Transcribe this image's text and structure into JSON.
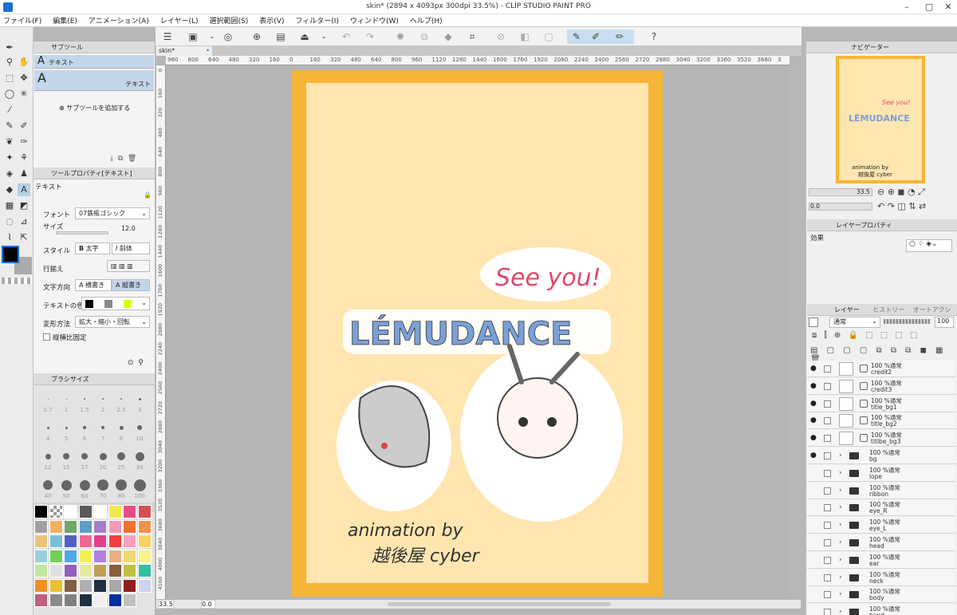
{
  "window": {
    "title": "skin* (2894 x 4093px 300dpi 33.5%)  - CLIP STUDIO PAINT PRO"
  },
  "menu": [
    "ファイル(F)",
    "編集(E)",
    "アニメーション(A)",
    "レイヤー(L)",
    "選択範囲(S)",
    "表示(V)",
    "フィルター(I)",
    "ウィンドウ(W)",
    "ヘルプ(H)"
  ],
  "subtool": {
    "header": "サブツール",
    "item1": "テキスト",
    "item2": "テキスト",
    "add": "サブツールを追加する"
  },
  "toolprop": {
    "header": "ツールプロパティ[テキスト]",
    "title": "テキスト",
    "font_label": "フォント",
    "font_value": "07鉄瓶ゴシック",
    "size_label": "サイズ",
    "size_value": "12.0",
    "style_label": "スタイル",
    "bold": "太字",
    "italic": "斜体",
    "align_label": "行揃え",
    "dir_label": "文字方向",
    "dir_h": "横書き",
    "dir_v": "縦書き",
    "color_label": "テキストの色",
    "transform_label": "変形方法",
    "transform_value": "拡大・縮小・回転",
    "aspect_label": "縦横比固定"
  },
  "brush": {
    "header": "ブラシサイズ",
    "sizes": [
      "0.7",
      "1",
      "1.5",
      "2",
      "2.5",
      "3",
      "4",
      "5",
      "6",
      "7",
      "8",
      "10",
      "12",
      "15",
      "17",
      "20",
      "25",
      "30",
      "40",
      "50",
      "60",
      "70",
      "80",
      "100"
    ]
  },
  "palette": {
    "colors": [
      "#000000",
      "checker",
      "#ffffff",
      "#5a5a5a",
      "#ffffff",
      "#f0e84a",
      "#e64b8a",
      "#d45050",
      "#a0a0a0",
      "#f5b062",
      "#6fa86a",
      "#5e9ec8",
      "#a080c8",
      "#f29ab8",
      "#f07030",
      "#f09050",
      "#e8c478",
      "#78c0d8",
      "#5060c0",
      "#f06890",
      "#e04090",
      "#f04040",
      "#f8a0c0",
      "#f8d060",
      "#98d0d8",
      "#70d058",
      "#50a8e8",
      "#f0f050",
      "#b080e0",
      "#e8b080",
      "#f0d870",
      "#f8f088",
      "#c0e8a0",
      "#e0e0e0",
      "#9060c0",
      "#e8e8a0",
      "#c0a058",
      "#886040",
      "#c0c040",
      "#30c0a0",
      "#f09020",
      "#e8c030",
      "#806040",
      "#b0b0b0",
      "#203040",
      "#a8a8a8",
      "#902020",
      "#d0d0f0",
      "#c06080",
      "#8a8a8a",
      "#808080",
      "#203040",
      "#f0f0f0",
      "#0030a0",
      "#c0c0c0"
    ]
  },
  "canvas": {
    "tab": "skin*",
    "zoom": "33.5",
    "angle": "0.0",
    "ruler_top": [
      "960",
      "800",
      "640",
      "480",
      "320",
      "160",
      "0",
      "160",
      "320",
      "480",
      "640",
      "800",
      "960",
      "1120",
      "1280",
      "1440",
      "1600",
      "1760",
      "1920",
      "2080",
      "2240",
      "2400",
      "2560",
      "2720",
      "2880",
      "3040",
      "3200",
      "3360",
      "3520",
      "3680",
      "3"
    ],
    "ruler_left": [
      "0",
      "160",
      "320",
      "480",
      "640",
      "800",
      "960",
      "1120",
      "1280",
      "1440",
      "1600",
      "1760",
      "1920",
      "2080",
      "2240",
      "2400",
      "2560",
      "2720",
      "2880",
      "3040",
      "3200",
      "3360",
      "3520",
      "3680",
      "3840",
      "4000",
      "4160"
    ]
  },
  "artwork": {
    "speech": "See you!",
    "title": "LÉMUDANCE",
    "credit1": "animation by",
    "credit2": "越後屋 cyber"
  },
  "navigator": {
    "header": "ナビゲーター",
    "zoom": "33.5",
    "angle": "0.0",
    "title": "LÉMUDANCE",
    "see": "See you!",
    "credit1": "animation by",
    "credit2": "越後屋 cyber"
  },
  "layerprop": {
    "header": "レイヤープロパティ",
    "effect": "効果"
  },
  "layers": {
    "tabs": [
      "レイヤー",
      "ヒストリー",
      "オートアクション"
    ],
    "blend": "通常",
    "opacity": "100",
    "items": [
      {
        "mode": "100 %通常",
        "name": "credit2",
        "type": "layer",
        "vis": true
      },
      {
        "mode": "100 %通常",
        "name": "credit3",
        "type": "layer",
        "vis": true
      },
      {
        "mode": "100 %通常",
        "name": "title_bg1",
        "type": "layer",
        "vis": true
      },
      {
        "mode": "100 %通常",
        "name": "title_bg2",
        "type": "layer",
        "vis": true
      },
      {
        "mode": "100 %通常",
        "name": "titlbe_bg3",
        "type": "layer",
        "vis": true
      },
      {
        "mode": "100 %通常",
        "name": "bg",
        "type": "folder",
        "vis": true
      },
      {
        "mode": "100 %通常",
        "name": "lope",
        "type": "folder",
        "vis": false
      },
      {
        "mode": "100 %通常",
        "name": "ribbon",
        "type": "folder",
        "vis": false
      },
      {
        "mode": "100 %通常",
        "name": "eye_R",
        "type": "folder",
        "vis": false
      },
      {
        "mode": "100 %通常",
        "name": "eye_L",
        "type": "folder",
        "vis": false
      },
      {
        "mode": "100 %通常",
        "name": "head",
        "type": "folder",
        "vis": false
      },
      {
        "mode": "100 %通常",
        "name": "ear",
        "type": "folder",
        "vis": false
      },
      {
        "mode": "100 %通常",
        "name": "neck",
        "type": "folder",
        "vis": false
      },
      {
        "mode": "100 %通常",
        "name": "body",
        "type": "folder",
        "vis": false
      },
      {
        "mode": "100 %通常",
        "name": "hand",
        "type": "folder",
        "vis": false
      }
    ]
  }
}
